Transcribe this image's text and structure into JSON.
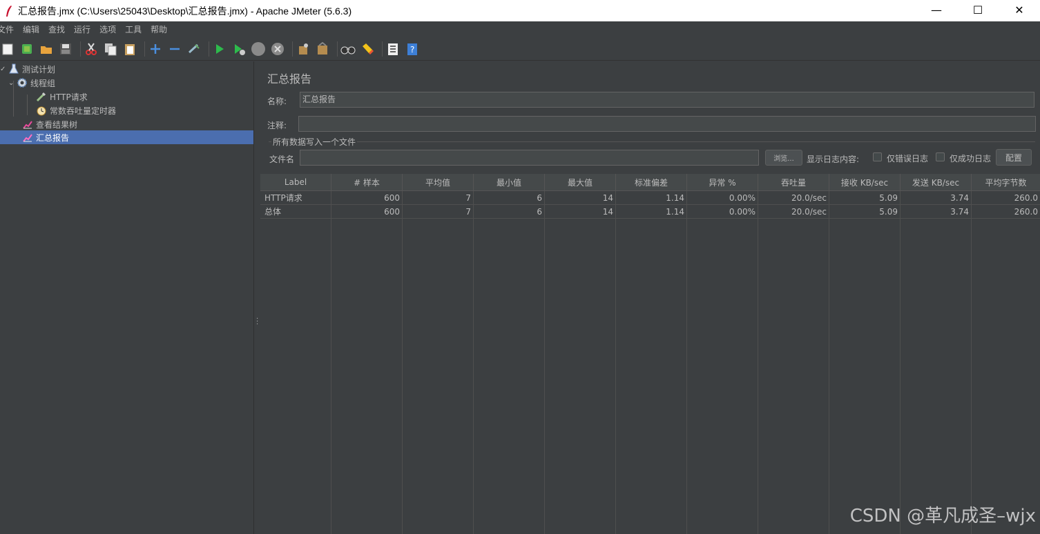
{
  "window": {
    "title": "汇总报告.jmx (C:\\Users\\25043\\Desktop\\汇总报告.jmx) - Apache JMeter (5.6.3)",
    "minimize": "—",
    "maximize": "☐",
    "close": "✕"
  },
  "menu": [
    "文件",
    "编辑",
    "查找",
    "运行",
    "选项",
    "工具",
    "帮助"
  ],
  "toolbar": {
    "icons": [
      "new-icon",
      "templates-icon",
      "open-icon",
      "save-icon",
      "cut-icon",
      "copy-icon",
      "paste-icon",
      "expand-icon",
      "collapse-icon",
      "toggle-icon",
      "start-icon",
      "start-no-pause-icon",
      "stop-icon",
      "shutdown-icon",
      "clear-icon",
      "clear-all-icon",
      "search-icon",
      "reset-search-icon",
      "function-helper-icon",
      "help-icon"
    ]
  },
  "tree": {
    "items": [
      {
        "label": "测试计划",
        "icon": "test-plan-icon"
      },
      {
        "label": "线程组",
        "icon": "gear-icon"
      },
      {
        "label": "HTTP请求",
        "icon": "pipette-icon"
      },
      {
        "label": "常数吞吐量定时器",
        "icon": "timer-icon"
      },
      {
        "label": "查看结果树",
        "icon": "listener-icon"
      },
      {
        "label": "汇总报告",
        "icon": "listener-icon"
      }
    ]
  },
  "panel": {
    "title": "汇总报告",
    "name_label": "名称:",
    "name_value": "汇总报告",
    "comment_label": "注释:",
    "comment_value": "",
    "fieldset_title": "所有数据写入一个文件",
    "filename_label": "文件名",
    "filename_value": "",
    "browse_label": "浏览...",
    "log_content_label": "显示日志内容:",
    "errors_only_label": "仅错误日志",
    "success_only_label": "仅成功日志",
    "configure_label": "配置"
  },
  "table": {
    "headers": [
      "Label",
      "# 样本",
      "平均值",
      "最小值",
      "最大值",
      "标准偏差",
      "异常 %",
      "吞吐量",
      "接收 KB/sec",
      "发送 KB/sec",
      "平均字节数"
    ],
    "rows": [
      [
        "HTTP请求",
        "600",
        "7",
        "6",
        "14",
        "1.14",
        "0.00%",
        "20.0/sec",
        "5.09",
        "3.74",
        "260.0"
      ],
      [
        "总体",
        "600",
        "7",
        "6",
        "14",
        "1.14",
        "0.00%",
        "20.0/sec",
        "5.09",
        "3.74",
        "260.0"
      ]
    ]
  },
  "watermark": "CSDN @革凡成圣–wjx"
}
